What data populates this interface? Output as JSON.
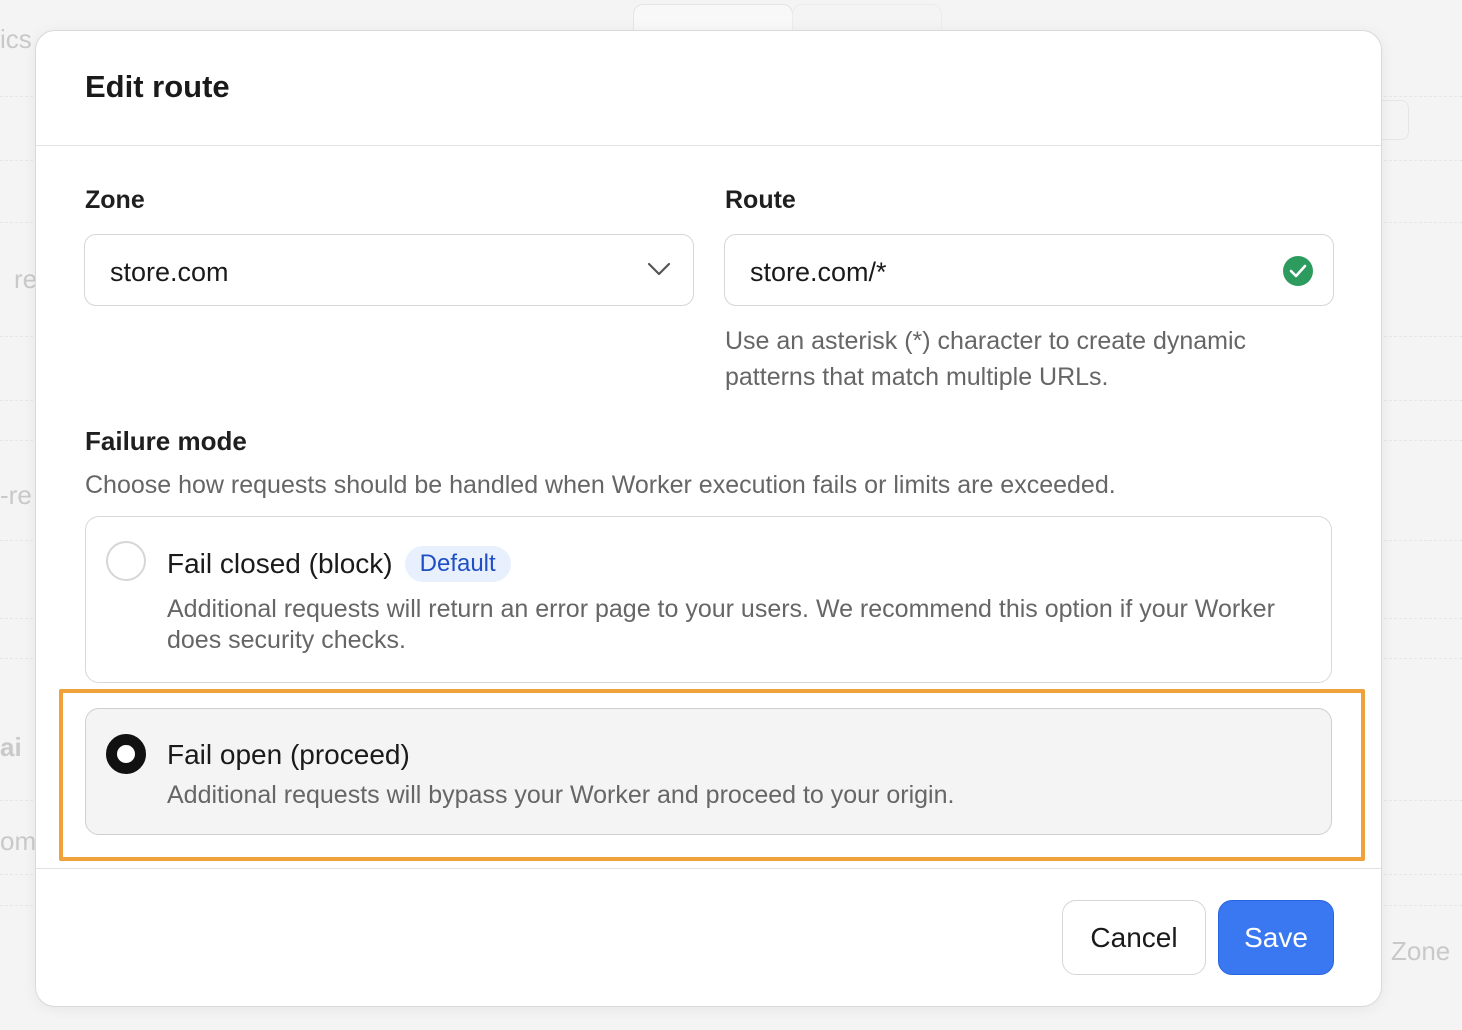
{
  "background": {
    "snippets": [
      "ics",
      "re",
      "-re",
      "ai",
      "om",
      "Zone"
    ]
  },
  "modal": {
    "title": "Edit route",
    "zone": {
      "label": "Zone",
      "value": "store.com"
    },
    "route": {
      "label": "Route",
      "value": "store.com/*",
      "help": "Use an asterisk (*) character to create dynamic patterns that match multiple URLs."
    },
    "failure_mode": {
      "title": "Failure mode",
      "description": "Choose how requests should be handled when Worker execution fails or limits are exceeded.",
      "options": [
        {
          "label": "Fail closed (block)",
          "badge": "Default",
          "description": "Additional requests will return an error page to your users. We recommend this option if your Worker does security checks.",
          "selected": false
        },
        {
          "label": "Fail open (proceed)",
          "description": "Additional requests will bypass your Worker and proceed to your origin.",
          "selected": true
        }
      ]
    },
    "buttons": {
      "cancel": "Cancel",
      "save": "Save"
    }
  },
  "colors": {
    "primary": "#3a78f2",
    "success": "#2e9b5e",
    "highlight": "#f0a13a",
    "badge_text": "#1f4fc4",
    "badge_bg": "#e9f0fd"
  }
}
